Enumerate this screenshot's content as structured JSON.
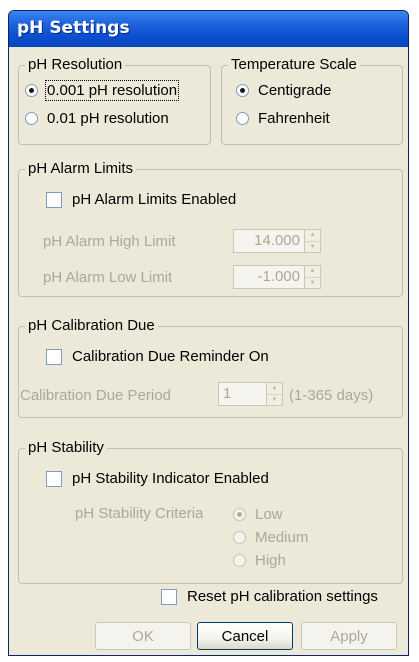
{
  "dialog": {
    "title": "pH Settings"
  },
  "resolution": {
    "legend": "pH Resolution",
    "options": [
      {
        "label": "0.001 pH resolution",
        "selected": true
      },
      {
        "label": "0.01 pH resolution",
        "selected": false
      }
    ]
  },
  "temperature": {
    "legend": "Temperature Scale",
    "options": [
      {
        "label": "Centigrade",
        "selected": true
      },
      {
        "label": "Fahrenheit",
        "selected": false
      }
    ]
  },
  "alarm": {
    "legend": "pH Alarm Limits",
    "enabled_label": "pH Alarm Limits Enabled",
    "enabled": false,
    "high_label": "pH Alarm High Limit",
    "high_value": "14.000",
    "low_label": "pH Alarm Low Limit",
    "low_value": "-1.000"
  },
  "calibration": {
    "legend": "pH Calibration Due",
    "reminder_label": "Calibration Due Reminder On",
    "reminder_on": false,
    "period_label": "Calibration Due Period",
    "period_value": "1",
    "period_hint": "(1-365 days)"
  },
  "stability": {
    "legend": "pH Stability",
    "indicator_label": "pH Stability Indicator Enabled",
    "indicator_enabled": false,
    "criteria_label": "pH Stability Criteria",
    "criteria_options": [
      {
        "label": "Low",
        "selected": true
      },
      {
        "label": "Medium",
        "selected": false
      },
      {
        "label": "High",
        "selected": false
      }
    ]
  },
  "reset": {
    "label": "Reset pH calibration settings",
    "checked": false
  },
  "buttons": {
    "ok": "OK",
    "cancel": "Cancel",
    "apply": "Apply"
  }
}
